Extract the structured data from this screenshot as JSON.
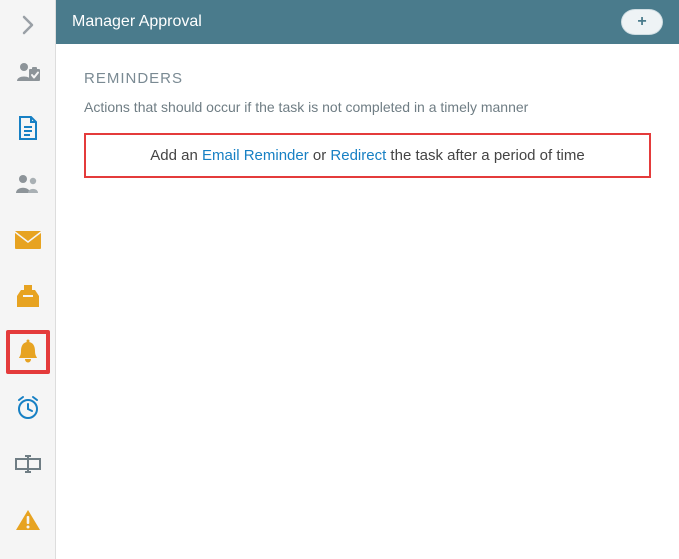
{
  "header": {
    "title": "Manager Approval",
    "add_label": "+"
  },
  "sidebar": {
    "toggle": "expand",
    "items": [
      {
        "icon": "user-check-icon",
        "color": "#7f8a90"
      },
      {
        "icon": "document-icon",
        "color": "#1780c4"
      },
      {
        "icon": "users-icon",
        "color": "#7f8a90"
      },
      {
        "icon": "envelope-icon",
        "color": "#e7a321"
      },
      {
        "icon": "ballot-box-icon",
        "color": "#e7a321"
      },
      {
        "icon": "bell-icon",
        "color": "#e7a321",
        "highlighted": true
      },
      {
        "icon": "alarm-clock-icon",
        "color": "#1780c4"
      },
      {
        "icon": "rename-icon",
        "color": "#6f7d84"
      },
      {
        "icon": "warning-icon",
        "color": "#e7a321"
      }
    ]
  },
  "reminders": {
    "title": "REMINDERS",
    "description": "Actions that should occur if the task is not completed in a timely manner",
    "prefix": "Add an ",
    "link1": "Email Reminder",
    "mid": " or ",
    "link2": "Redirect",
    "suffix": " the task after a period of time"
  }
}
